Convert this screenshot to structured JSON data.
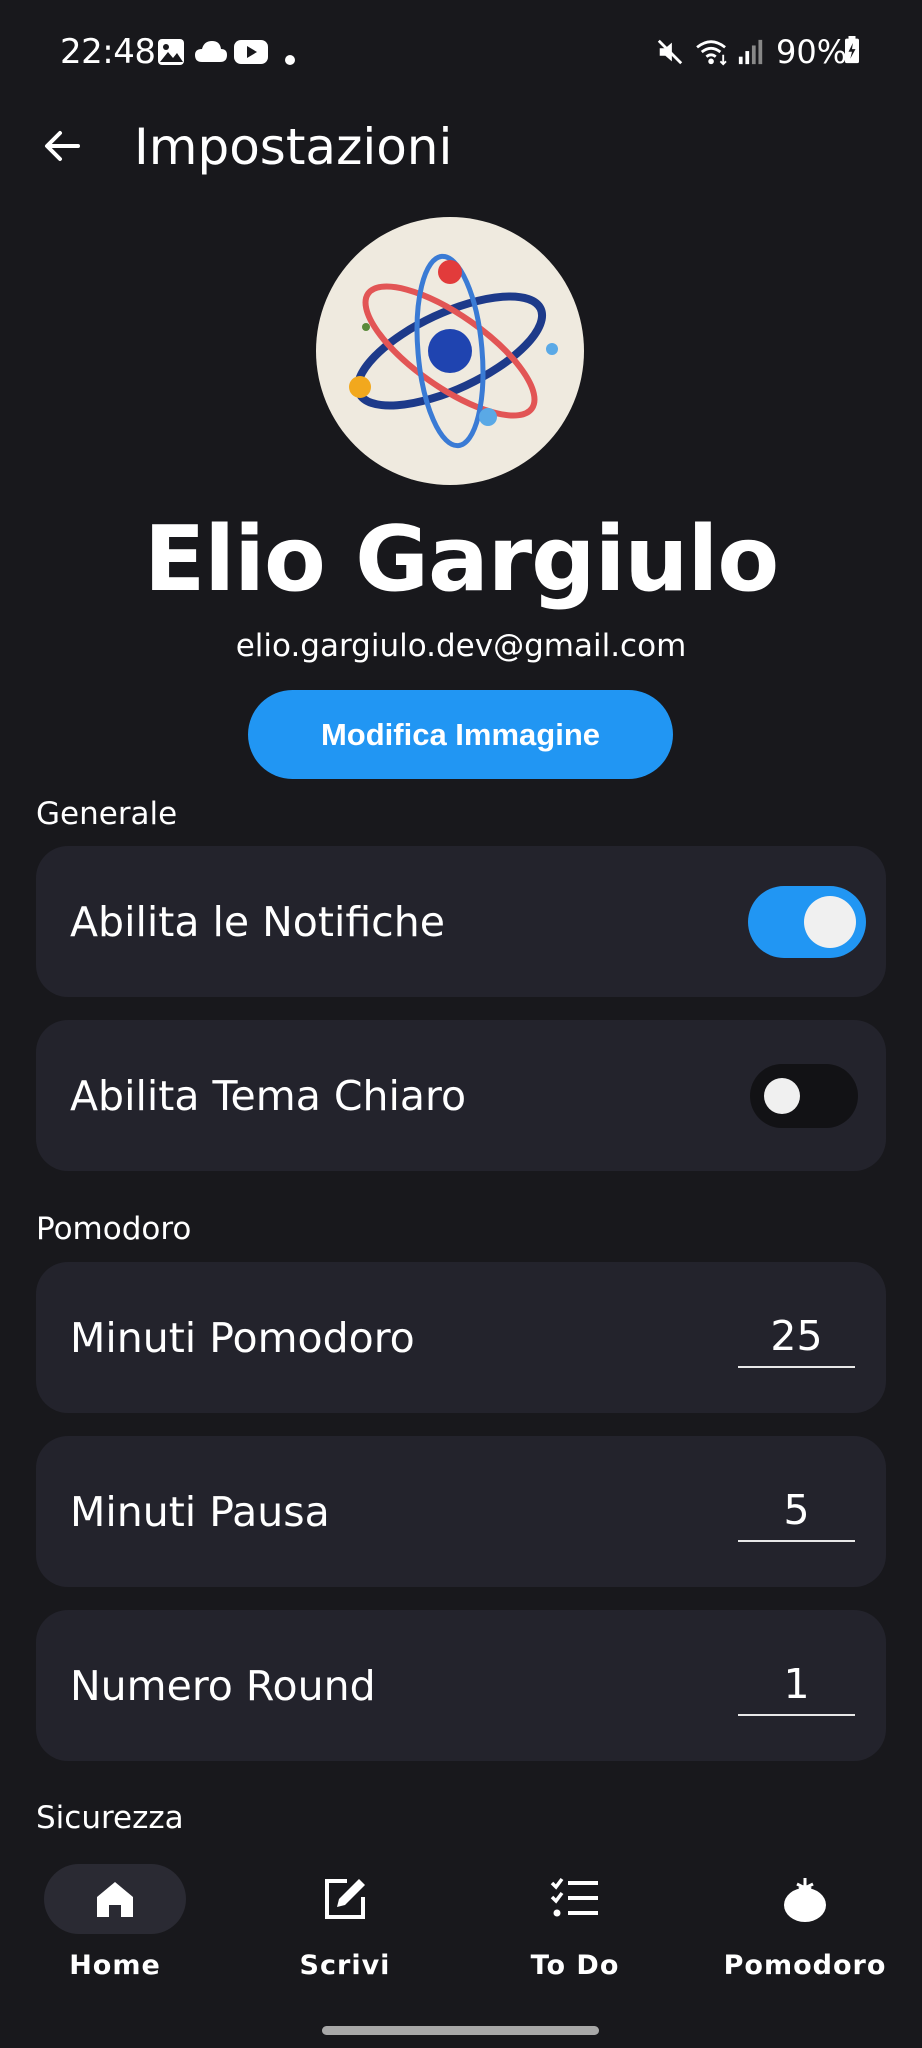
{
  "status_bar": {
    "time": "22:48",
    "battery": "90%",
    "icons": [
      "image-icon",
      "cloud-icon",
      "youtube-icon",
      "dot-icon",
      "mute-icon",
      "wifi-icon",
      "signal-icon",
      "battery-icon"
    ]
  },
  "header": {
    "title": "Impostazioni"
  },
  "profile": {
    "name": "Elio Gargiulo",
    "email": "elio.gargiulo.dev@gmail.com",
    "edit_image_label": "Modifica Immagine"
  },
  "sections": {
    "general_title": "Generale",
    "pomodoro_title": "Pomodoro",
    "security_title": "Sicurezza"
  },
  "settings": {
    "notifications": {
      "label": "Abilita le Notifiche",
      "enabled": true
    },
    "light_theme": {
      "label": "Abilita Tema Chiaro",
      "enabled": false
    },
    "pomodoro_minutes": {
      "label": "Minuti Pomodoro",
      "value": "25"
    },
    "pause_minutes": {
      "label": "Minuti Pausa",
      "value": "5"
    },
    "rounds": {
      "label": "Numero Round",
      "value": "1"
    }
  },
  "bottom_nav": {
    "items": [
      {
        "label": "Home",
        "icon": "home-icon",
        "active": true
      },
      {
        "label": "Scrivi",
        "icon": "edit-icon",
        "active": false
      },
      {
        "label": "To Do",
        "icon": "checklist-icon",
        "active": false
      },
      {
        "label": "Pomodoro",
        "icon": "tomato-icon",
        "active": false
      }
    ]
  },
  "colors": {
    "background": "#18181c",
    "card": "#23232c",
    "accent": "#2196f3"
  }
}
